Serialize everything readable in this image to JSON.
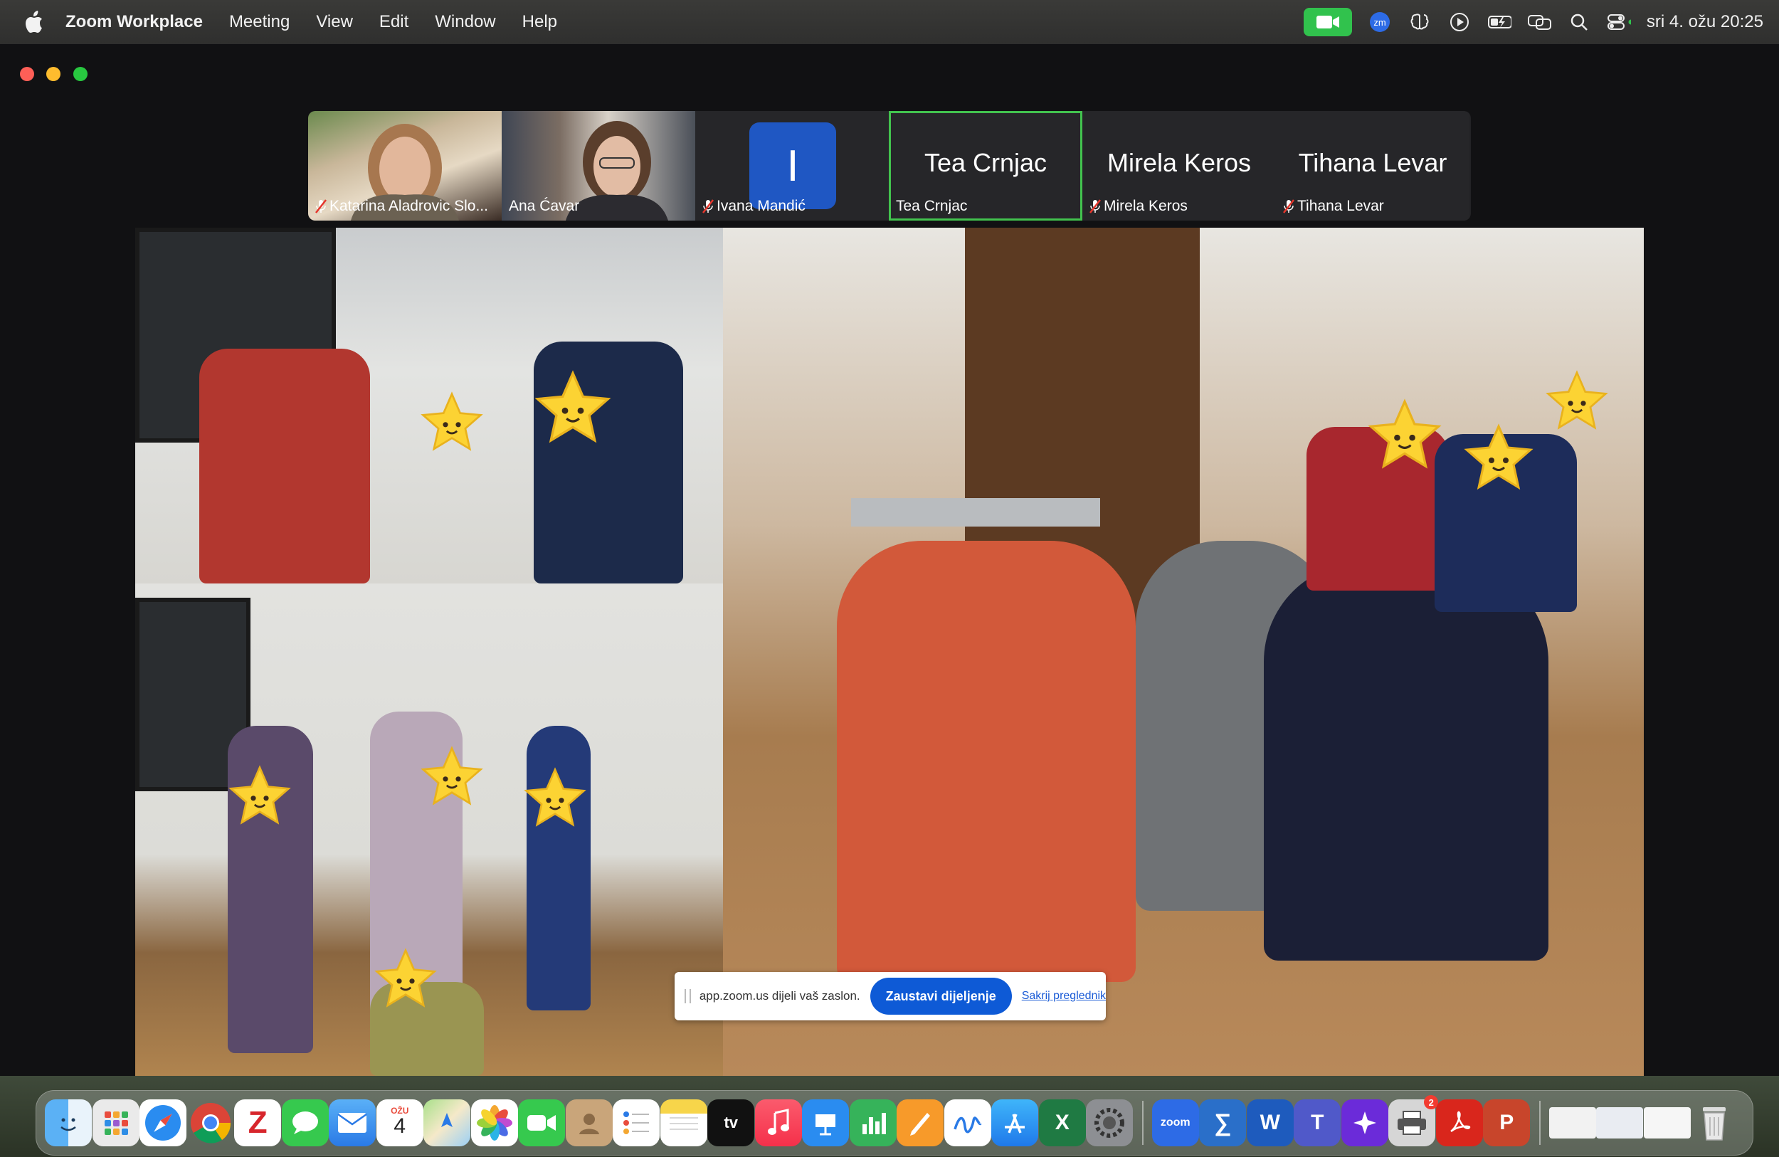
{
  "menubar": {
    "app_name": "Zoom Workplace",
    "menus": [
      "Meeting",
      "View",
      "Edit",
      "Window",
      "Help"
    ],
    "status_icons": [
      "zoom-camera-icon",
      "zoom-app-icon",
      "brain-icon",
      "play-icon",
      "battery-icon",
      "screen-mirror-icon",
      "search-icon",
      "control-center-icon"
    ],
    "clock": "sri 4. ožu 20:25"
  },
  "gallery": {
    "participants": [
      {
        "name": "Katarina Aladrovic Slo...",
        "muted": true,
        "video": true
      },
      {
        "name": "Ana Ćavar",
        "muted": false,
        "video": true
      },
      {
        "name": "Ivana Mandić",
        "muted": true,
        "video": false,
        "avatar_letter": "I"
      },
      {
        "name": "Tea Crnjac",
        "display": "Tea Crnjac",
        "muted": false,
        "video": false,
        "active_speaker": true
      },
      {
        "name": "Mirela Keros",
        "display": "Mirela Keros",
        "muted": true,
        "video": false
      },
      {
        "name": "Tihana Levar",
        "display": "Tihana Levar",
        "muted": true,
        "video": false
      }
    ]
  },
  "share_banner": {
    "text": "app.zoom.us dijeli vaš zaslon.",
    "stop_label": "Zaustavi dijeljenje",
    "hide_label": "Sakrij preglednik"
  },
  "dock": {
    "calendar_month": "OŽU",
    "calendar_day": "4",
    "tv_label": "tv",
    "zoom_label": "zoom",
    "printer_badge": "2",
    "apps": [
      "finder-icon",
      "launchpad-icon",
      "safari-icon",
      "chrome-icon",
      "zotero-icon",
      "messages-icon",
      "mail-icon",
      "calendar-icon",
      "maps-icon",
      "photos-icon",
      "facetime-icon",
      "contacts-icon",
      "reminders-icon",
      "notes-icon",
      "apple-tv-icon",
      "music-icon",
      "keynote-icon",
      "numbers-icon",
      "pages-icon",
      "freeform-icon",
      "app-store-icon",
      "excel-icon",
      "system-settings-icon",
      "zoom-icon",
      "sigma-icon",
      "word-icon",
      "teams-icon",
      "perplexity-icon",
      "printer-icon",
      "acrobat-icon",
      "powerpoint-icon",
      "document-thumb-icon",
      "document-thumb-icon-2",
      "document-thumb-icon-3",
      "trash-icon"
    ]
  },
  "colors": {
    "active_speaker": "#42c34e",
    "share_button": "#0e5ad6",
    "avatar": "#1f57c3",
    "camera_status": "#31c24d"
  }
}
